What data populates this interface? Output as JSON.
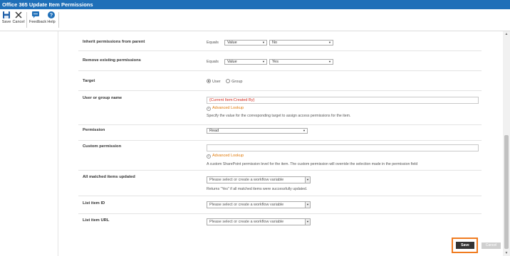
{
  "window": {
    "title": "Office 365 Update Item Permissions"
  },
  "ribbon": {
    "save_label": "Save",
    "cancel_label": "Cancel",
    "feedback_label": "Feedback",
    "help_label": "Help",
    "accent": "#1f6fb8"
  },
  "form": {
    "inherit": {
      "label": "Inherit permissions from parent",
      "equals": "Equals",
      "operand": "Value",
      "value": "No"
    },
    "remove": {
      "label": "Remove existing permissions",
      "equals": "Equals",
      "operand": "Value",
      "value": "Yes"
    },
    "target": {
      "label": "Target",
      "options": [
        "User",
        "Group"
      ],
      "selected": "User"
    },
    "user_or_group": {
      "label": "User or group name",
      "value": "{Current Item:Created By}",
      "lookup": "Advanced Lookup",
      "help": "Specify the value for the corresponding target to assign access permissions for the item."
    },
    "permission": {
      "label": "Permission",
      "value": "Read"
    },
    "custom_permission": {
      "label": "Custom permission",
      "value": "",
      "lookup": "Advanced Lookup",
      "help": "A custom SharePoint permission level for the item. The custom permission will override the selection made in the permission field"
    },
    "all_matched": {
      "label": "All matched items updated",
      "placeholder": "Please select or create a workflow variable",
      "help": "Returns \"Yes\" if all matched items were successfully updated."
    },
    "list_item_id": {
      "label": "List item ID",
      "placeholder": "Please select or create a workflow variable"
    },
    "list_item_url": {
      "label": "List item URL",
      "placeholder": "Please select or create a workflow variable"
    }
  },
  "footer": {
    "save_label": "Save",
    "cancel_label": "Cancel",
    "highlight_color": "#f07b1f"
  }
}
